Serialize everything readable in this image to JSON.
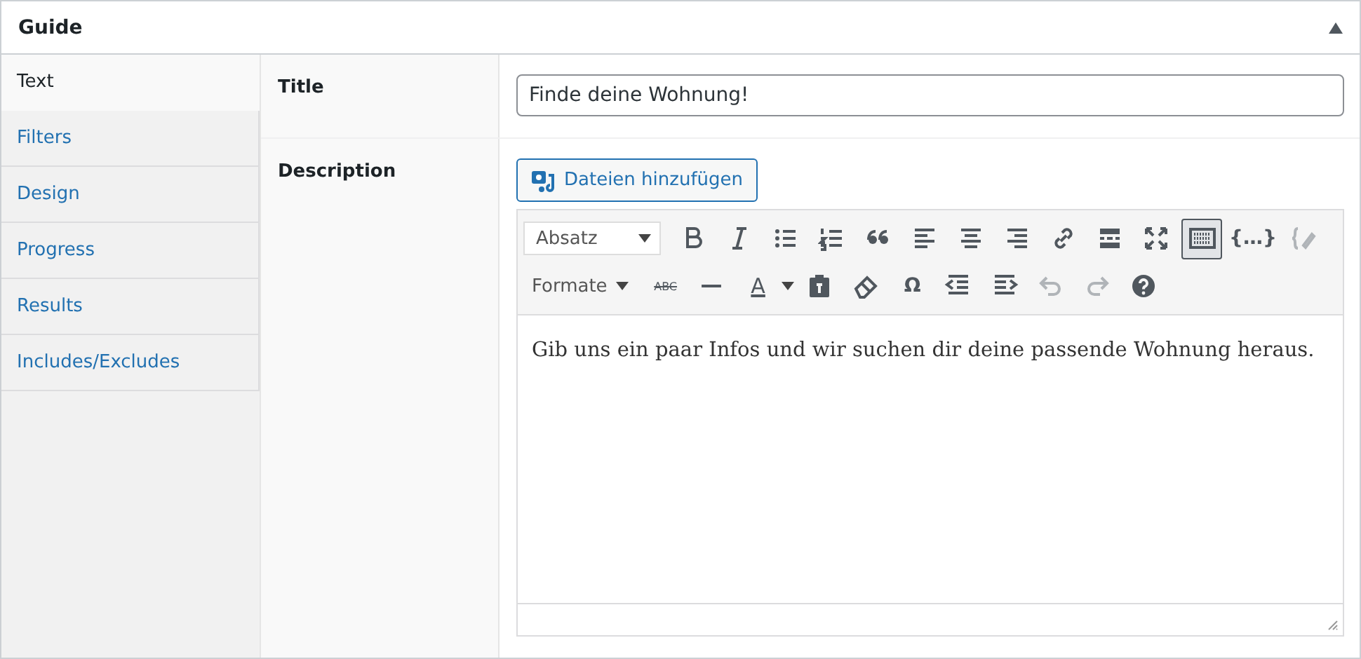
{
  "panel": {
    "title": "Guide",
    "collapsed": false
  },
  "tabs": [
    {
      "label": "Text",
      "selected": true
    },
    {
      "label": "Filters",
      "selected": false
    },
    {
      "label": "Design",
      "selected": false
    },
    {
      "label": "Progress",
      "selected": false
    },
    {
      "label": "Results",
      "selected": false
    },
    {
      "label": "Includes/Excludes",
      "selected": false
    }
  ],
  "fields": [
    {
      "label": "Title",
      "kind": "text",
      "value": "Finde deine Wohnung!"
    },
    {
      "label": "Description",
      "kind": "editor",
      "media_button": "Dateien hinzufügen",
      "toolbar_rows": [
        [
          {
            "kind": "select",
            "label": "Absatz"
          },
          {
            "kind": "bold"
          },
          {
            "kind": "italic"
          },
          {
            "kind": "bullets"
          },
          {
            "kind": "numbers"
          },
          {
            "kind": "quote"
          },
          {
            "kind": "align-left"
          },
          {
            "kind": "align-center"
          },
          {
            "kind": "align-right"
          },
          {
            "kind": "link"
          },
          {
            "kind": "more"
          },
          {
            "kind": "fullscreen"
          },
          {
            "kind": "toolbar",
            "active": true
          },
          {
            "kind": "glyph",
            "label": "{…}"
          },
          {
            "kind": "pencil",
            "disabled": true
          }
        ],
        [
          {
            "kind": "menu",
            "label": "Formate"
          },
          {
            "kind": "strike",
            "label": "ABC"
          },
          {
            "kind": "hr"
          },
          {
            "kind": "color",
            "label": "A"
          },
          {
            "kind": "paste"
          },
          {
            "kind": "eraser"
          },
          {
            "kind": "glyph",
            "label": "Ω"
          },
          {
            "kind": "outdent"
          },
          {
            "kind": "indent"
          },
          {
            "kind": "undo",
            "disabled": true
          },
          {
            "kind": "redo",
            "disabled": true
          },
          {
            "kind": "help"
          }
        ]
      ],
      "content": "Gib uns ein paar Infos und wir suchen dir deine passende Wohnung heraus."
    }
  ]
}
